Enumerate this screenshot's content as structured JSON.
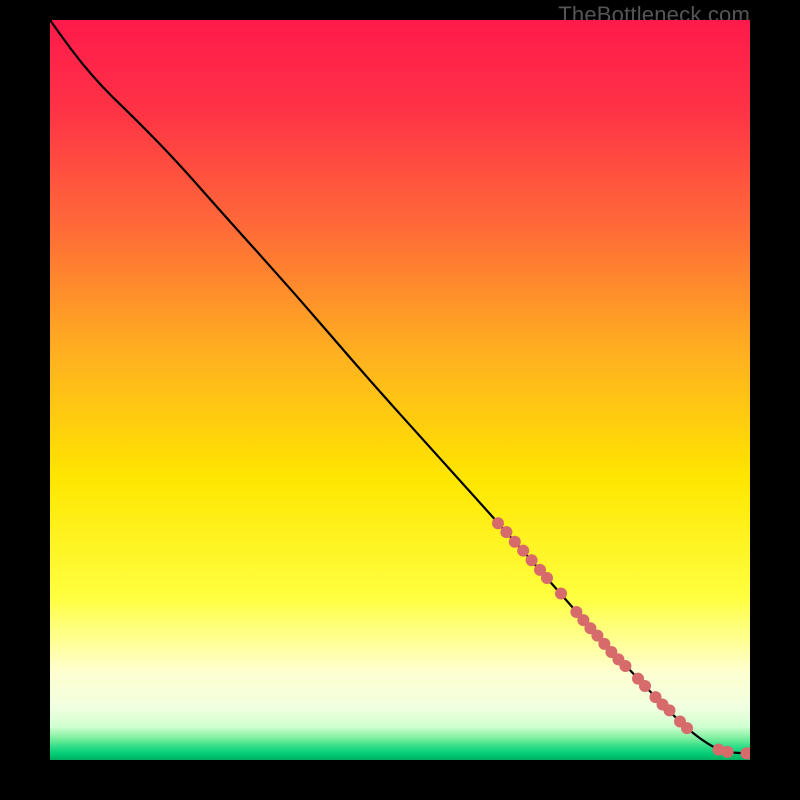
{
  "watermark": "TheBottleneck.com",
  "colors": {
    "background": "#000000",
    "gradient_stops": [
      {
        "offset": 0.0,
        "color": "#ff1a4b"
      },
      {
        "offset": 0.12,
        "color": "#ff3246"
      },
      {
        "offset": 0.28,
        "color": "#ff6a38"
      },
      {
        "offset": 0.45,
        "color": "#ffb020"
      },
      {
        "offset": 0.62,
        "color": "#ffe600"
      },
      {
        "offset": 0.78,
        "color": "#ffff40"
      },
      {
        "offset": 0.88,
        "color": "#ffffd0"
      },
      {
        "offset": 0.93,
        "color": "#f0ffe0"
      },
      {
        "offset": 0.955,
        "color": "#d0ffd0"
      },
      {
        "offset": 0.97,
        "color": "#80f0a0"
      },
      {
        "offset": 0.982,
        "color": "#30dd88"
      },
      {
        "offset": 0.992,
        "color": "#00cc77"
      },
      {
        "offset": 1.0,
        "color": "#00b060"
      }
    ],
    "curve": "#000000",
    "marker": "#d76a6a"
  },
  "chart_data": {
    "type": "line",
    "title": "",
    "xlabel": "",
    "ylabel": "",
    "xlim": [
      0,
      100
    ],
    "ylim": [
      0,
      100
    ],
    "grid": false,
    "legend": false,
    "series": [
      {
        "name": "curve",
        "x": [
          0,
          3,
          6,
          9,
          12,
          18,
          25,
          35,
          45,
          55,
          65,
          72,
          78,
          84,
          88,
          91,
          93,
          95,
          97,
          100
        ],
        "y": [
          100,
          96,
          92.5,
          89.5,
          86.8,
          81,
          73.5,
          63,
          52,
          41.5,
          31,
          23.5,
          17,
          11,
          7,
          4.3,
          2.8,
          1.6,
          1.0,
          0.9
        ]
      }
    ],
    "markers": {
      "name": "highlighted-points",
      "color": "#d76a6a",
      "radius_px": 6,
      "points": [
        {
          "x": 64.0,
          "y": 32.0
        },
        {
          "x": 65.2,
          "y": 30.8
        },
        {
          "x": 66.4,
          "y": 29.5
        },
        {
          "x": 67.6,
          "y": 28.3
        },
        {
          "x": 68.8,
          "y": 27.0
        },
        {
          "x": 70.0,
          "y": 25.7
        },
        {
          "x": 71.0,
          "y": 24.6
        },
        {
          "x": 73.0,
          "y": 22.5
        },
        {
          "x": 75.2,
          "y": 20.0
        },
        {
          "x": 76.2,
          "y": 18.9
        },
        {
          "x": 77.2,
          "y": 17.8
        },
        {
          "x": 78.2,
          "y": 16.8
        },
        {
          "x": 79.2,
          "y": 15.7
        },
        {
          "x": 80.2,
          "y": 14.6
        },
        {
          "x": 81.2,
          "y": 13.6
        },
        {
          "x": 82.2,
          "y": 12.7
        },
        {
          "x": 84.0,
          "y": 11.0
        },
        {
          "x": 85.0,
          "y": 10.0
        },
        {
          "x": 86.5,
          "y": 8.5
        },
        {
          "x": 87.5,
          "y": 7.5
        },
        {
          "x": 88.5,
          "y": 6.7
        },
        {
          "x": 90.0,
          "y": 5.2
        },
        {
          "x": 91.0,
          "y": 4.3
        },
        {
          "x": 95.5,
          "y": 1.4
        },
        {
          "x": 96.8,
          "y": 1.1
        },
        {
          "x": 99.5,
          "y": 0.9
        },
        {
          "x": 100.0,
          "y": 0.9
        }
      ]
    }
  }
}
